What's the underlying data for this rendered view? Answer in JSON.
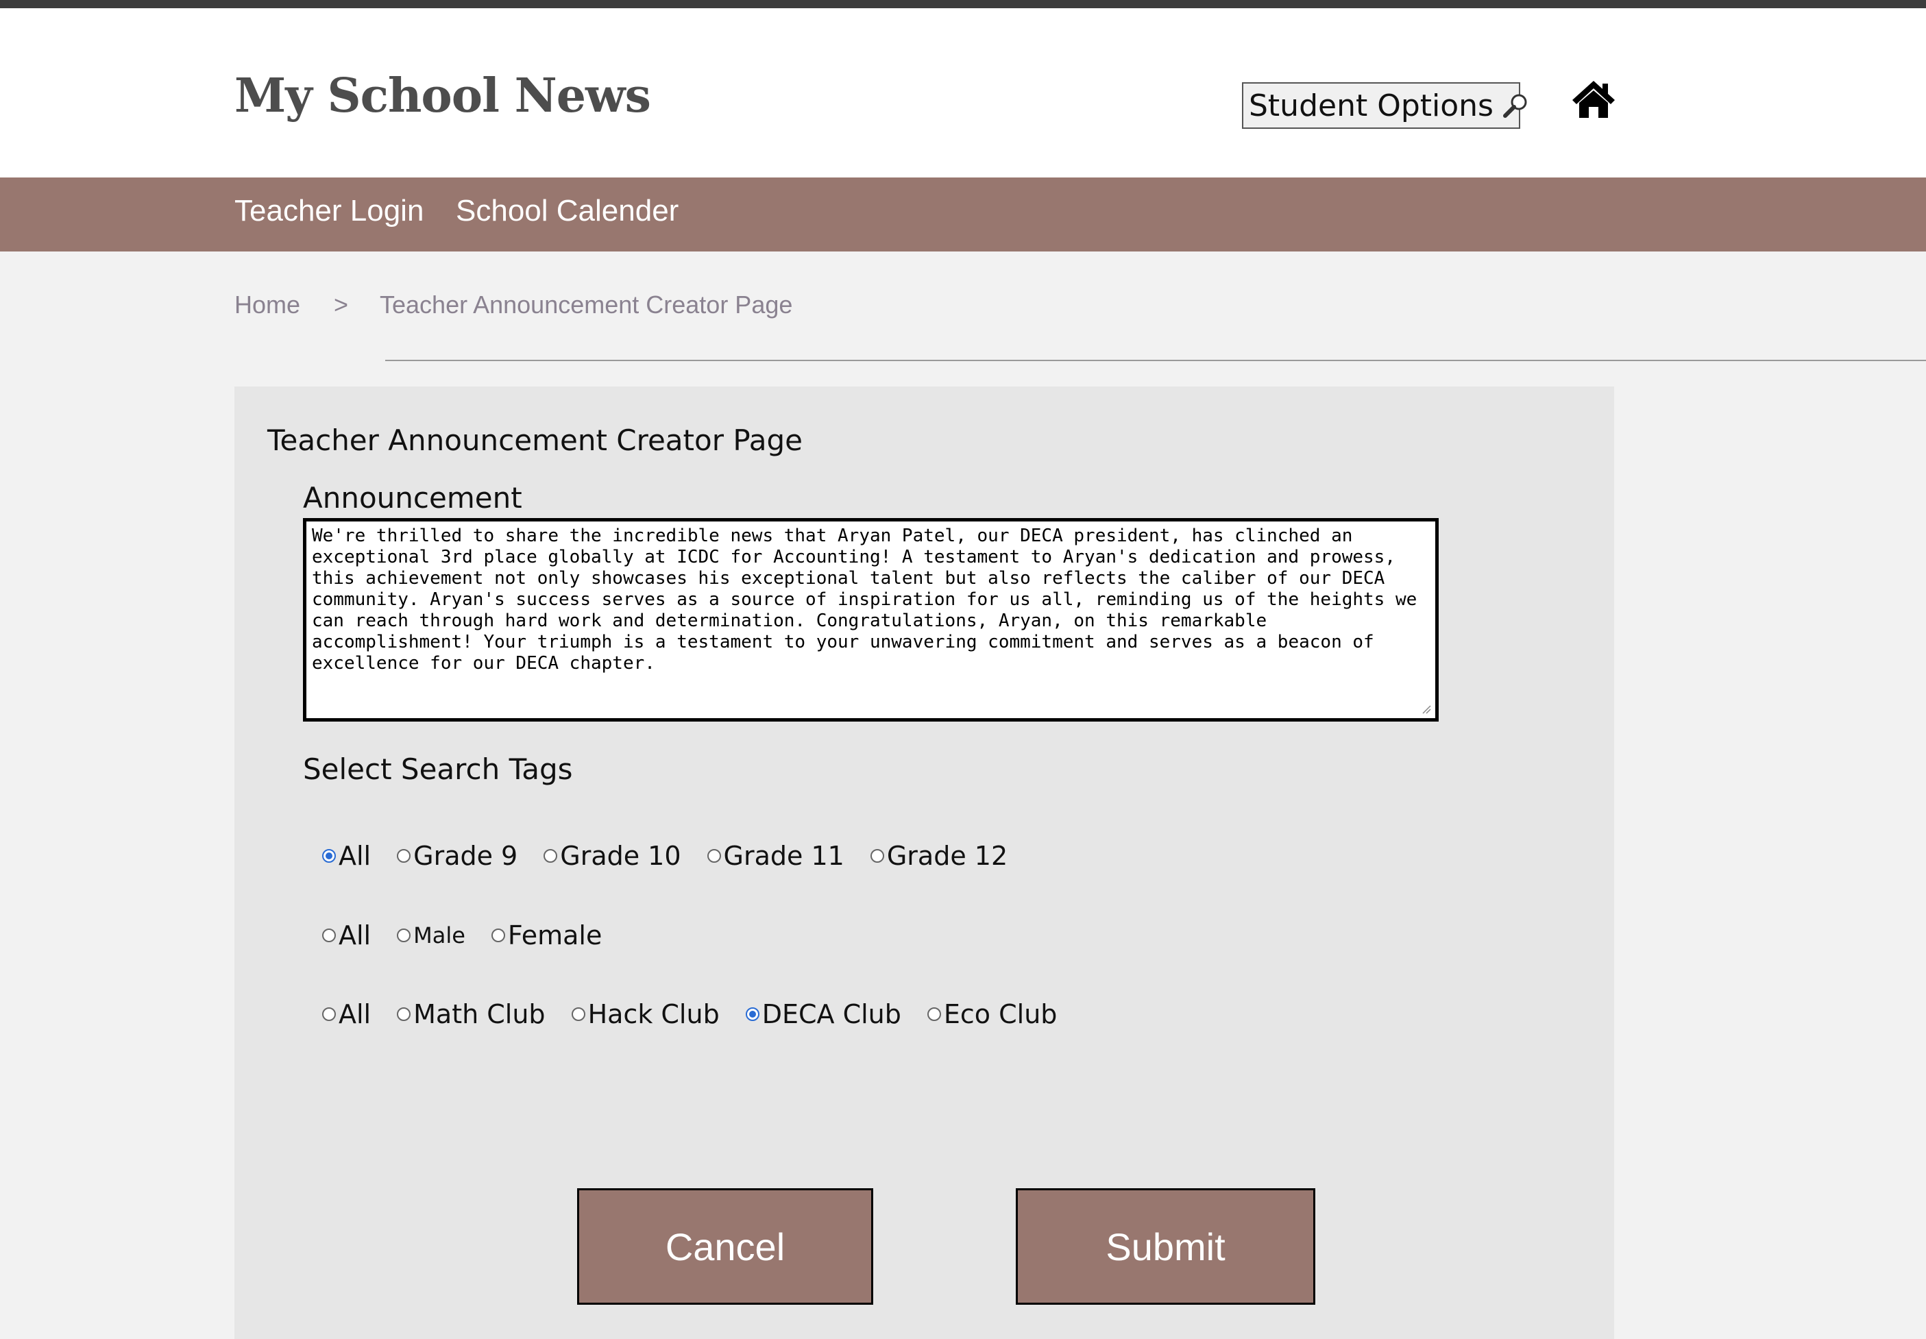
{
  "header": {
    "site_title": "My School News",
    "student_options_label": "Student Options",
    "student_options_icon": "magnifier-icon",
    "home_icon": "home-icon"
  },
  "nav": {
    "items": [
      {
        "label": "Teacher Login"
      },
      {
        "label": "School Calender"
      }
    ]
  },
  "breadcrumb": {
    "home": "Home",
    "separator": ">",
    "current": "Teacher Announcement Creator Page"
  },
  "form": {
    "title": "Teacher Announcement Creator Page",
    "announcement_label": "Announcement",
    "announcement_text": "We're thrilled to share the incredible news that Aryan Patel, our DECA president, has clinched an exceptional 3rd place globally at ICDC for Accounting! A testament to Aryan's dedication and prowess, this achievement not only showcases his exceptional talent but also reflects the caliber of our DECA community. Aryan's success serves as a source of inspiration for us all, reminding us of the heights we can reach through hard work and determination. Congratulations, Aryan, on this remarkable accomplishment! Your triumph is a testament to your unwavering commitment and serves as a beacon of excellence for our DECA chapter.",
    "tags_label": "Select Search Tags",
    "grade_options": [
      {
        "label": "All",
        "checked": true
      },
      {
        "label": "Grade 9",
        "checked": false
      },
      {
        "label": "Grade 10",
        "checked": false
      },
      {
        "label": "Grade 11",
        "checked": false
      },
      {
        "label": "Grade 12",
        "checked": false
      }
    ],
    "gender_options": [
      {
        "label": "All",
        "checked": false
      },
      {
        "label": "Male",
        "checked": false
      },
      {
        "label": "Female",
        "checked": false
      }
    ],
    "club_options": [
      {
        "label": "All",
        "checked": false
      },
      {
        "label": "Math Club",
        "checked": false
      },
      {
        "label": "Hack Club",
        "checked": false
      },
      {
        "label": "DECA Club",
        "checked": true
      },
      {
        "label": "Eco Club",
        "checked": false
      }
    ],
    "cancel_label": "Cancel",
    "submit_label": "Submit"
  },
  "colors": {
    "nav_bg": "#98776f",
    "button_bg": "#98776f",
    "radio_accent": "#2a6cd4",
    "breadcrumb_text": "#8a8290"
  }
}
